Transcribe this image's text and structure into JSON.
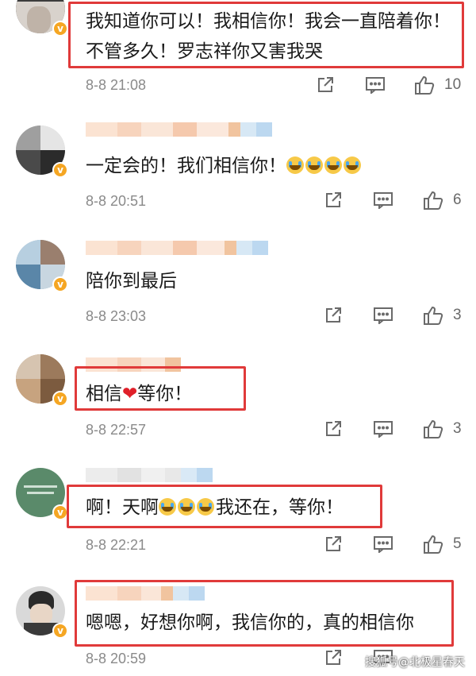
{
  "comments": [
    {
      "text": "我知道你可以！我相信你！我会一直陪着你！不管多久！罗志祥你又害我哭",
      "time": "8-8 21:08",
      "likes": "10"
    },
    {
      "text_prefix": "一定会的！我们相信你！",
      "emoji_count": 4,
      "time": "8-8 20:51",
      "likes": "6"
    },
    {
      "text": "陪你到最后",
      "time": "8-8 23:03",
      "likes": "3"
    },
    {
      "text_a": "相信",
      "heart": "❤",
      "text_b": "等你！",
      "time": "8-8 22:57",
      "likes": "3"
    },
    {
      "text_a": "啊！天啊",
      "emoji_count": 3,
      "text_b": "我还在，等你！",
      "time": "8-8 22:21",
      "likes": "5"
    },
    {
      "text": "嗯嗯，好想你啊，我信你的，真的相信你",
      "time": "8-8 20:59",
      "likes": ""
    }
  ],
  "icons": {
    "share": "share-icon",
    "comment": "comment-icon",
    "like": "like-icon",
    "verified": "verified-badge-icon"
  },
  "verified_mark": "v",
  "watermark": "搜狐号@北极星春天",
  "colors": {
    "highlight_box": "#e03a3a",
    "verified": "#f5a623",
    "meta_text": "#8a8a8a"
  }
}
